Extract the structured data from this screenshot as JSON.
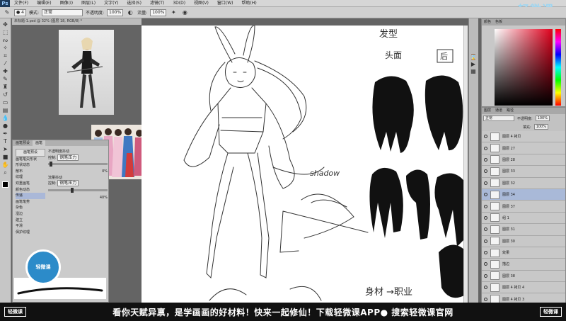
{
  "menubar": {
    "app_logo": "Ps",
    "items": [
      "文件(F)",
      "编辑(E)",
      "图像(I)",
      "图层(L)",
      "文字(Y)",
      "选择(S)",
      "滤镜(T)",
      "3D(D)",
      "视图(V)",
      "窗口(W)",
      "帮助(H)"
    ]
  },
  "options": {
    "mode_label": "模式:",
    "mode_value": "正常",
    "opacity_label": "不透明度:",
    "opacity_value": "100%",
    "flow_label": "流量:",
    "flow_value": "100%"
  },
  "document": {
    "tab_title": "未标题-1.psd @ 32% (图层 18, RGB/8) *"
  },
  "brush_panel": {
    "tabs": [
      "画笔预设",
      "画笔"
    ],
    "preset_button": "画笔预设",
    "items": [
      "画笔笔尖形状",
      "形状动态",
      "散布",
      "纹理",
      "双重画笔",
      "颜色动态",
      "传递",
      "画笔笔势",
      "杂色",
      "湿边",
      "建立",
      "平滑",
      "保护纹理"
    ],
    "right_labels": [
      "不透明度抖动",
      "控制:",
      "钢笔压力",
      "流量抖动",
      "控制:",
      "钢笔压力"
    ],
    "values": [
      "0%",
      "40%"
    ]
  },
  "logo_circle": "轻微课",
  "canvas_text": {
    "hair_title": "发型",
    "front": "头面",
    "back": "后",
    "bottom_note": "身材 →职业",
    "side_note": "shadow"
  },
  "color_panel": {
    "tabs": [
      "颜色",
      "色板"
    ]
  },
  "watermark": "轻微课",
  "layers_panel": {
    "tabs": [
      "图层",
      "通道",
      "路径"
    ],
    "blend_mode": "正常",
    "opacity_label": "不透明度:",
    "opacity_value": "100%",
    "fill_label": "填充:",
    "fill_value": "100%",
    "layers": [
      "图层 4 拷贝",
      "图层 27",
      "图层 28",
      "图层 33",
      "图层 32",
      "图层 34",
      "图层 37",
      "组 1",
      "图层 31",
      "图层 30",
      "效果",
      "描边",
      "图层 38",
      "图层 4 拷贝 4",
      "图层 4 拷贝 3"
    ],
    "selected_index": 5
  },
  "banner": {
    "left_logo": "轻微课",
    "text": "看你天赋异禀，是学画画的好材料！快来一起修仙！下载轻微课APP● 搜索轻微课官网",
    "right_logo": "轻微课"
  },
  "colors": {
    "banner_bg": "#111111",
    "brand_blue": "#2c8bc9",
    "selected_layer": "#a9b9d8"
  }
}
